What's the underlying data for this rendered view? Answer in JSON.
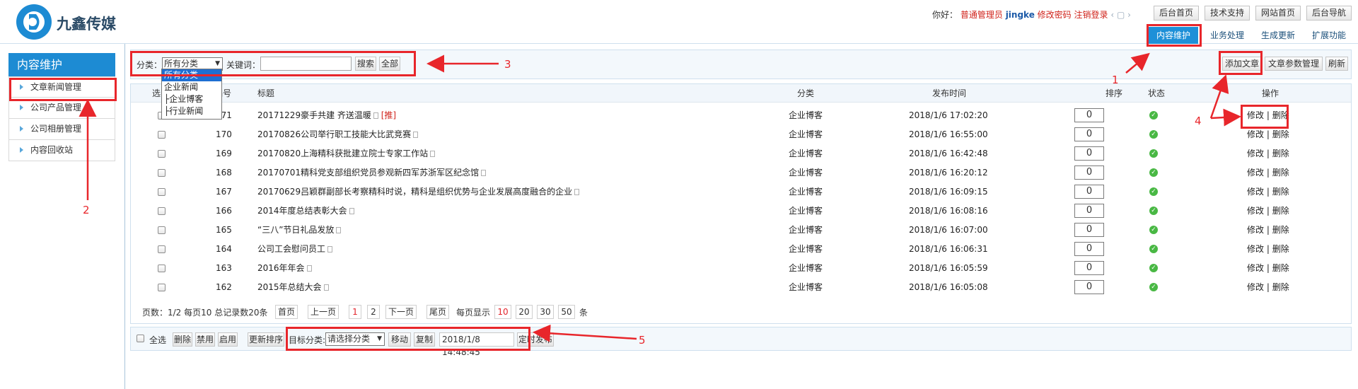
{
  "brand": {
    "name": "九鑫传媒"
  },
  "header": {
    "greeting": "你好：",
    "role": "普通管理员",
    "username": "jingke",
    "change_pwd": "修改密码",
    "logout": "注销登录",
    "top_buttons": [
      "后台首页",
      "技术支持",
      "网站首页",
      "后台导航"
    ],
    "tabs": [
      "内容维护",
      "业务处理",
      "生成更新",
      "扩展功能"
    ],
    "active_tab": "内容维护"
  },
  "sidebar": {
    "title": "内容维护",
    "items": [
      "文章新闻管理",
      "公司产品管理",
      "公司相册管理",
      "内容回收站"
    ]
  },
  "filter": {
    "category_label": "分类：",
    "category_value": "所有分类",
    "keyword_label": "关键词：",
    "keyword_value": "",
    "search_btn": "搜索",
    "all_btn": "全部",
    "dropdown_options": [
      "所有分类",
      "企业新闻",
      "├企业博客",
      "├行业新闻"
    ]
  },
  "actions": {
    "add_article": "添加文章",
    "article_params": "文章参数管理",
    "refresh": "刷新"
  },
  "table": {
    "headers": [
      "选",
      "编号",
      "标题",
      "分类",
      "发布时间",
      "排序",
      "状态",
      "操作"
    ],
    "rows": [
      {
        "id": "171",
        "title": "20171229豪手共建 齐送温暖",
        "tag": "[推]",
        "category": "企业博客",
        "time": "2018/1/6 17:02:20",
        "sort": "0"
      },
      {
        "id": "170",
        "title": "20170826公司举行职工技能大比武竞赛",
        "tag": "",
        "category": "企业博客",
        "time": "2018/1/6 16:55:00",
        "sort": "0"
      },
      {
        "id": "169",
        "title": "20170820上海精科获批建立院士专家工作站",
        "tag": "",
        "category": "企业博客",
        "time": "2018/1/6 16:42:48",
        "sort": "0"
      },
      {
        "id": "168",
        "title": "20170701精科党支部组织党员参观新四军苏浙军区纪念馆",
        "tag": "",
        "category": "企业博客",
        "time": "2018/1/6 16:20:12",
        "sort": "0"
      },
      {
        "id": "167",
        "title": "20170629吕颖群副部长考察精科时说，精科是组织优势与企业发展高度融合的企业",
        "tag": "",
        "category": "企业博客",
        "time": "2018/1/6 16:09:15",
        "sort": "0"
      },
      {
        "id": "166",
        "title": "2014年度总结表彰大会",
        "tag": "",
        "category": "企业博客",
        "time": "2018/1/6 16:08:16",
        "sort": "0"
      },
      {
        "id": "165",
        "title": "“三八”节日礼品发放",
        "tag": "",
        "category": "企业博客",
        "time": "2018/1/6 16:07:00",
        "sort": "0"
      },
      {
        "id": "164",
        "title": "公司工会慰问员工",
        "tag": "",
        "category": "企业博客",
        "time": "2018/1/6 16:06:31",
        "sort": "0"
      },
      {
        "id": "163",
        "title": "2016年年会",
        "tag": "",
        "category": "企业博客",
        "time": "2018/1/6 16:05:59",
        "sort": "0"
      },
      {
        "id": "162",
        "title": "2015年总结大会",
        "tag": "",
        "category": "企业博客",
        "time": "2018/1/6 16:05:08",
        "sort": "0"
      }
    ],
    "edit": "修改",
    "sep": "|",
    "del": "删除"
  },
  "pagination": {
    "info": "页数：1/2 每页10 总记录数20条",
    "first": "首页",
    "prev": "上一页",
    "pages": [
      "1",
      "2"
    ],
    "next": "下一页",
    "last": "尾页",
    "per_page_label": "每页显示",
    "per_page_options": [
      "10",
      "20",
      "30",
      "50"
    ],
    "per_page_unit": "条"
  },
  "bottom": {
    "select_all": "全选",
    "delete": "删除",
    "disable": "禁用",
    "enable": "启用",
    "update_sort": "更新排序",
    "target_label": "目标分类:",
    "target_value": "请选择分类",
    "move": "移动",
    "copy": "复制",
    "datetime": "2018/1/8 14:48:45",
    "schedule": "定时发布"
  },
  "annotations": [
    "1",
    "2",
    "3",
    "4",
    "5"
  ],
  "colors": {
    "accent": "#1d8bd3",
    "highlight": "#e8262b",
    "status_ok": "#49b844"
  }
}
